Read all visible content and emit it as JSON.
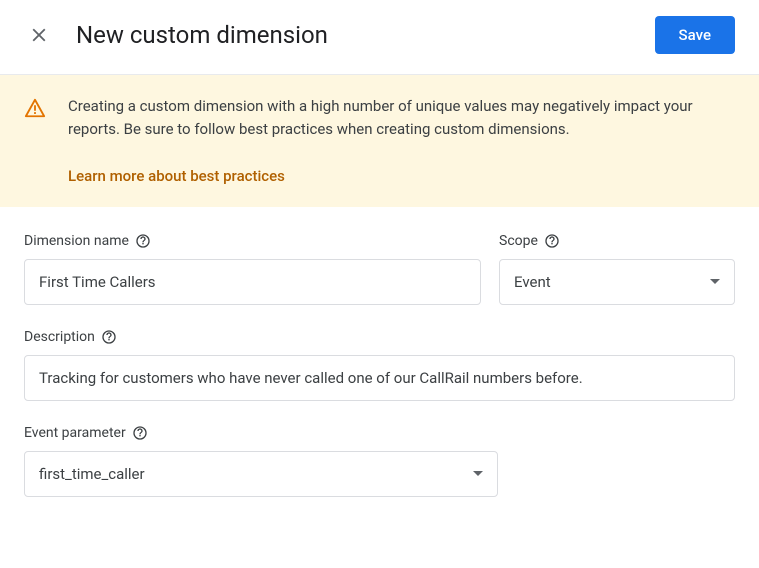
{
  "header": {
    "title": "New custom dimension",
    "save_label": "Save"
  },
  "alert": {
    "text": "Creating a custom dimension with a high number of unique values may negatively impact your reports. Be sure to follow best practices when creating custom dimensions.",
    "link_label": "Learn more about best practices"
  },
  "form": {
    "name_label": "Dimension name",
    "name_value": "First Time Callers",
    "scope_label": "Scope",
    "scope_value": "Event",
    "description_label": "Description",
    "description_value": "Tracking for customers who have never called one of our CallRail numbers before.",
    "param_label": "Event parameter",
    "param_value": "first_time_caller"
  }
}
